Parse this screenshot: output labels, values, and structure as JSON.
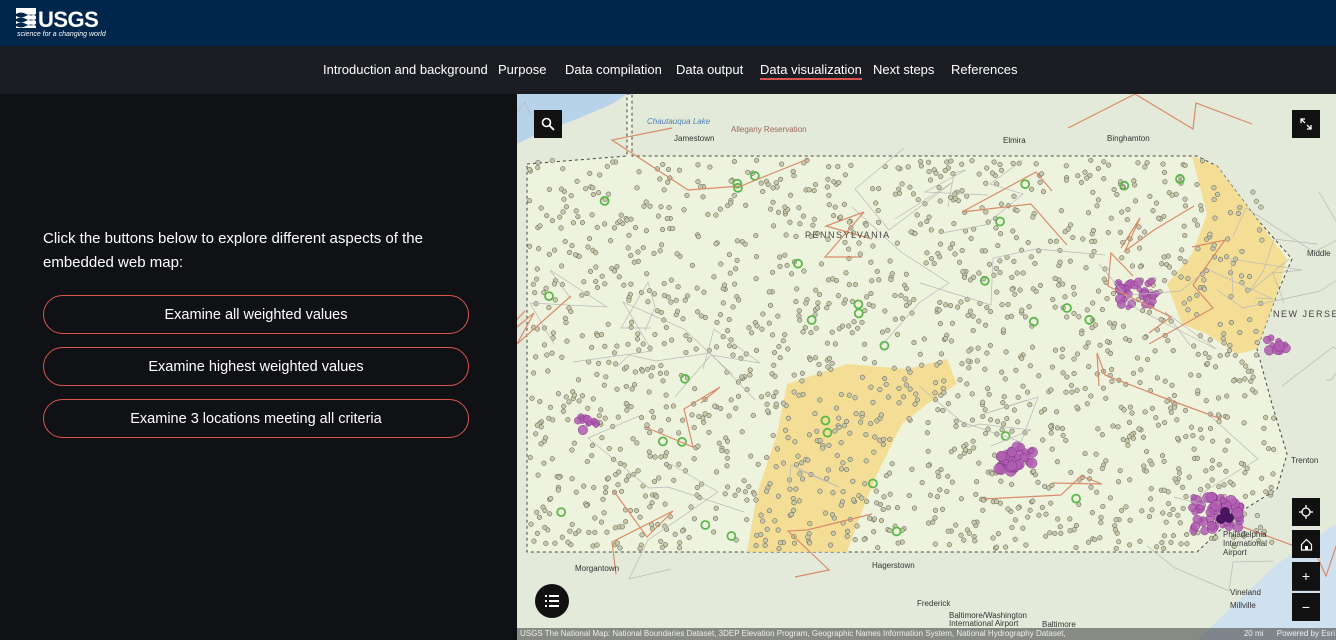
{
  "header": {
    "logo_text": "USGS",
    "logo_tagline": "science for a changing world"
  },
  "nav": {
    "items": [
      {
        "label": "Introduction and background"
      },
      {
        "label": "Purpose"
      },
      {
        "label": "Data compilation"
      },
      {
        "label": "Data output"
      },
      {
        "label": "Data visualization"
      },
      {
        "label": "Next steps"
      },
      {
        "label": "References"
      }
    ],
    "active": "Data visualization"
  },
  "panel": {
    "intro": "Click the buttons below to explore different aspects of the embedded web map:",
    "buttons": [
      {
        "label": "Examine all weighted values"
      },
      {
        "label": "Examine highest weighted values"
      },
      {
        "label": "Examine 3 locations meeting all criteria"
      }
    ]
  },
  "map": {
    "labels": {
      "chautauqua": "Chautauqua Lake",
      "jamestown": "Jamestown",
      "allegany": "Allegany Reservation",
      "elmira": "Elmira",
      "binghamton": "Binghamton",
      "pennsylvania": "PENNSYLVANIA",
      "middletown": "Middle",
      "newjersey": "NEW JERSE",
      "trenton": "Trenton",
      "philadelphia": "Philadelphia International Airport",
      "morgantown": "Morgantown",
      "hagerstown": "Hagerstown",
      "frederick": "Frederick",
      "baltimore": "Baltimore",
      "bwi": "Baltimore/Washington International Airport",
      "vineland": "Vineland",
      "millville": "Millville"
    },
    "attribution": "USGS The National Map: National Boundaries Dataset, 3DEP Elevation Program, Geographic Names Information System, National Hydrography Dataset,",
    "scale": "20 mi",
    "powered_by": "Powered by Esri",
    "tools": {
      "search_icon": "search-icon",
      "expand_icon": "expand-icon",
      "locate_icon": "locate-icon",
      "home_icon": "home-icon",
      "zoom_in": "+",
      "zoom_out": "−",
      "legend_icon": "list-icon"
    },
    "colors": {
      "site_point": "#c9c9a8",
      "weighted_high": "#b15db3",
      "weighted_top": "#4a1560",
      "criteria_point": "#5bb84a",
      "yellow_region": "#f5d98a"
    }
  }
}
